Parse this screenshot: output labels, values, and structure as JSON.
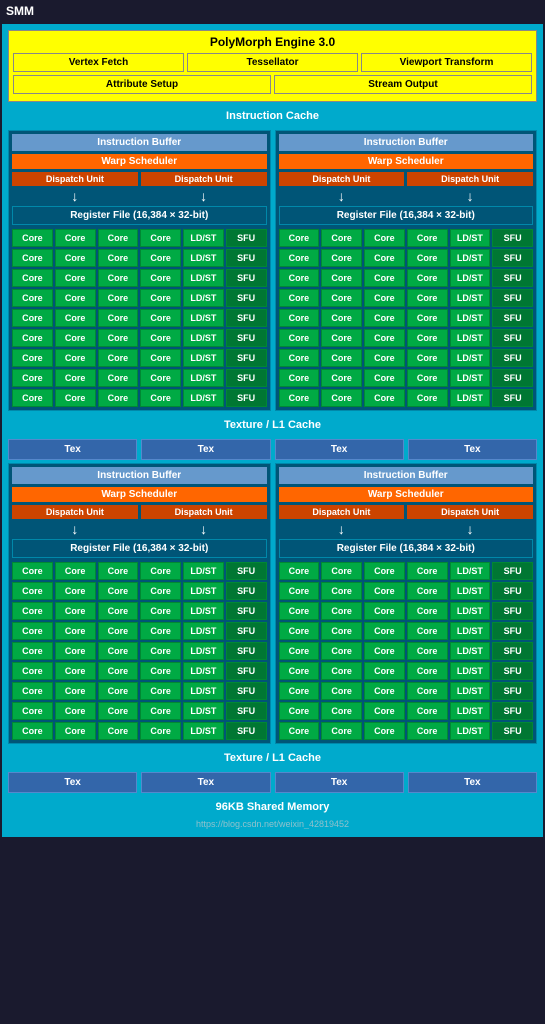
{
  "smm": {
    "label": "SMM",
    "polymorph": {
      "title": "PolyMorph Engine 3.0",
      "row1": [
        "Vertex Fetch",
        "Tessellator",
        "Viewport Transform"
      ],
      "row2": [
        "Attribute Setup",
        "Stream Output"
      ]
    },
    "instruction_cache": "Instruction Cache",
    "warp_blocks": [
      {
        "instruction_buffer": "Instruction Buffer",
        "warp_scheduler": "Warp Scheduler",
        "dispatch_units": [
          "Dispatch Unit",
          "Dispatch Unit"
        ],
        "register_file": "Register File (16,384 × 32-bit)"
      },
      {
        "instruction_buffer": "Instruction Buffer",
        "warp_scheduler": "Warp Scheduler",
        "dispatch_units": [
          "Dispatch Unit",
          "Dispatch Unit"
        ],
        "register_file": "Register File (16,384 × 32-bit)"
      }
    ],
    "core_rows": [
      [
        "Core",
        "Core",
        "Core",
        "Core",
        "LD/ST",
        "SFU"
      ],
      [
        "Core",
        "Core",
        "Core",
        "Core",
        "LD/ST",
        "SFU"
      ],
      [
        "Core",
        "Core",
        "Core",
        "Core",
        "LD/ST",
        "SFU"
      ],
      [
        "Core",
        "Core",
        "Core",
        "Core",
        "LD/ST",
        "SFU"
      ],
      [
        "Core",
        "Core",
        "Core",
        "Core",
        "LD/ST",
        "SFU"
      ],
      [
        "Core",
        "Core",
        "Core",
        "Core",
        "LD/ST",
        "SFU"
      ],
      [
        "Core",
        "Core",
        "Core",
        "Core",
        "LD/ST",
        "SFU"
      ],
      [
        "Core",
        "Core",
        "Core",
        "Core",
        "LD/ST",
        "SFU"
      ],
      [
        "Core",
        "Core",
        "Core",
        "Core",
        "LD/ST",
        "SFU"
      ]
    ],
    "texture_cache": "Texture / L1 Cache",
    "tex_labels": [
      "Tex",
      "Tex",
      "Tex",
      "Tex"
    ],
    "warp_blocks2": [
      {
        "instruction_buffer": "Instruction Buffer",
        "warp_scheduler": "Warp Scheduler",
        "dispatch_units": [
          "Dispatch Unit",
          "Dispatch Unit"
        ],
        "register_file": "Register File (16,384 × 32-bit)"
      },
      {
        "instruction_buffer": "Instruction Buffer",
        "warp_scheduler": "Warp Scheduler",
        "dispatch_units": [
          "Dispatch Unit",
          "Dispatch Unit"
        ],
        "register_file": "Register File (16,384 × 32-bit)"
      }
    ],
    "core_rows2": [
      [
        "Core",
        "Core",
        "Core",
        "Core",
        "LD/ST",
        "SFU"
      ],
      [
        "Core",
        "Core",
        "Core",
        "Core",
        "LD/ST",
        "SFU"
      ],
      [
        "Core",
        "Core",
        "Core",
        "Core",
        "LD/ST",
        "SFU"
      ],
      [
        "Core",
        "Core",
        "Core",
        "Core",
        "LD/ST",
        "SFU"
      ],
      [
        "Core",
        "Core",
        "Core",
        "Core",
        "LD/ST",
        "SFU"
      ],
      [
        "Core",
        "Core",
        "Core",
        "Core",
        "LD/ST",
        "SFU"
      ],
      [
        "Core",
        "Core",
        "Core",
        "Core",
        "LD/ST",
        "SFU"
      ],
      [
        "Core",
        "Core",
        "Core",
        "Core",
        "LD/ST",
        "SFU"
      ],
      [
        "Core",
        "Core",
        "Core",
        "Core",
        "LD/ST",
        "SFU"
      ]
    ],
    "texture_cache2": "Texture / L1 Cache",
    "tex_labels2": [
      "Tex",
      "Tex",
      "Tex",
      "Tex"
    ],
    "shared_memory": "96KB Shared Memory",
    "watermark": "https://blog.csdn.net/weixin_42819452"
  }
}
